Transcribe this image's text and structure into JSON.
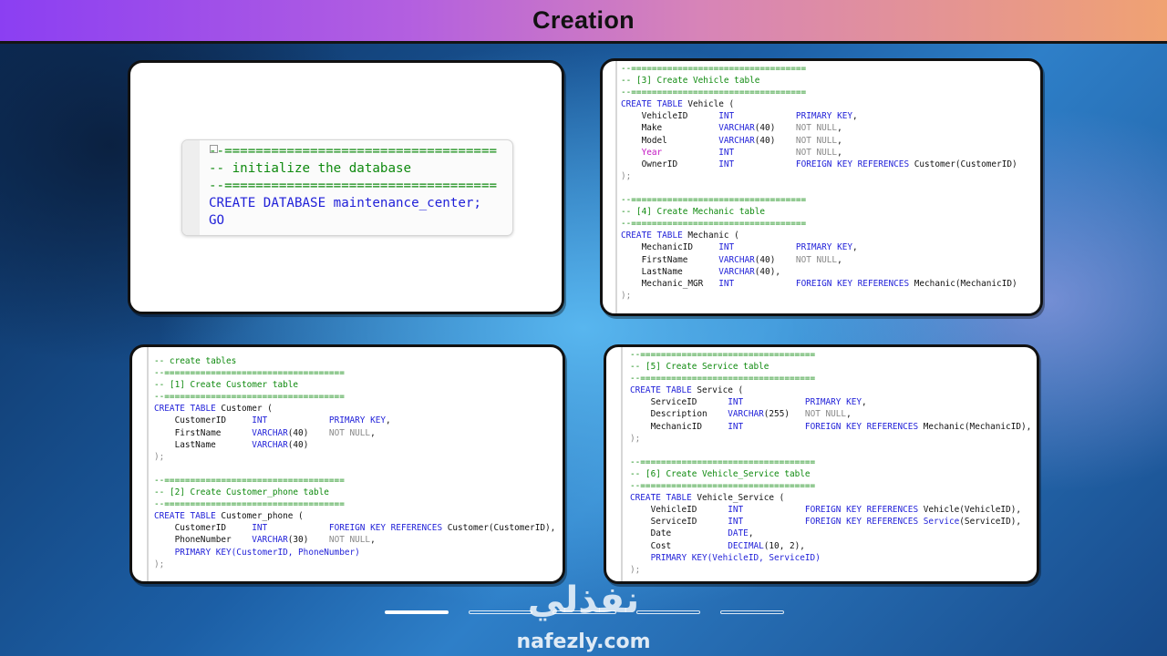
{
  "header": {
    "title": "Creation"
  },
  "init_panel": {
    "lines": [
      "--===================================",
      "-- initialize the database",
      "--===================================",
      "CREATE DATABASE maintenance_center;",
      "GO"
    ]
  },
  "vehicle_mechanic_panel": {
    "sep": "--==================================",
    "vehicle_comment": "-- [3] Create Vehicle table",
    "vehicle_create": "CREATE TABLE Vehicle (",
    "vehicle_rows": [
      "VehicleID      INT            PRIMARY KEY,",
      "Make           VARCHAR(40)    NOT NULL,",
      "Model          VARCHAR(40)    NOT NULL,",
      "Year           INT            NOT NULL,",
      "OwnerID        INT            FOREIGN KEY REFERENCES Customer(CustomerID)"
    ],
    "close": ");",
    "mechanic_comment": "-- [4] Create Mechanic table",
    "mechanic_create": "CREATE TABLE Mechanic (",
    "mechanic_rows": [
      "MechanicID     INT            PRIMARY KEY,",
      "FirstName      VARCHAR(40)    NOT NULL,",
      "LastName       VARCHAR(40),",
      "Mechanic_MGR   INT            FOREIGN KEY REFERENCES Mechanic(MechanicID)"
    ]
  },
  "customer_panel": {
    "create_tables_comment": "-- create tables",
    "sep": "--===================================",
    "customer_comment": "-- [1] Create Customer table",
    "customer_create": "CREATE TABLE Customer (",
    "customer_rows": [
      "CustomerID     INT            PRIMARY KEY,",
      "FirstName      VARCHAR(40)    NOT NULL,",
      "LastName       VARCHAR(40)"
    ],
    "close": ");",
    "phone_comment": "-- [2] Create Customer_phone table",
    "phone_create": "CREATE TABLE Customer_phone (",
    "phone_rows": [
      "CustomerID     INT            FOREIGN KEY REFERENCES Customer(CustomerID),",
      "PhoneNumber    VARCHAR(30)    NOT NULL,",
      "PRIMARY KEY(CustomerID, PhoneNumber)"
    ]
  },
  "service_panel": {
    "sep": "--==================================",
    "service_comment": "-- [5] Create Service table",
    "service_create": "CREATE TABLE Service (",
    "service_rows": [
      "ServiceID      INT            PRIMARY KEY,",
      "Description    VARCHAR(255)   NOT NULL,",
      "MechanicID     INT            FOREIGN KEY REFERENCES Mechanic(MechanicID),"
    ],
    "close": ");",
    "vs_comment": "-- [6] Create Vehicle_Service table",
    "vs_create": "CREATE TABLE Vehicle_Service (",
    "vs_rows": [
      "VehicleID      INT            FOREIGN KEY REFERENCES Vehicle(VehicleID),",
      "ServiceID      INT            FOREIGN KEY REFERENCES Service(ServiceID),",
      "Date           DATE,",
      "Cost           DECIMAL(10, 2),",
      "PRIMARY KEY(VehicleID, ServiceID)"
    ]
  },
  "footer": {
    "logo_arabic": "نفذلي",
    "logo_text": "nafezly.com",
    "slides": [
      "slide-1",
      "slide-2",
      "slide-3",
      "slide-4"
    ],
    "active_slide": 1
  },
  "colors": {
    "keyword": "#1f1fd8",
    "comment": "#0f8a0f",
    "muted": "#888888",
    "magenta": "#c316c3"
  }
}
